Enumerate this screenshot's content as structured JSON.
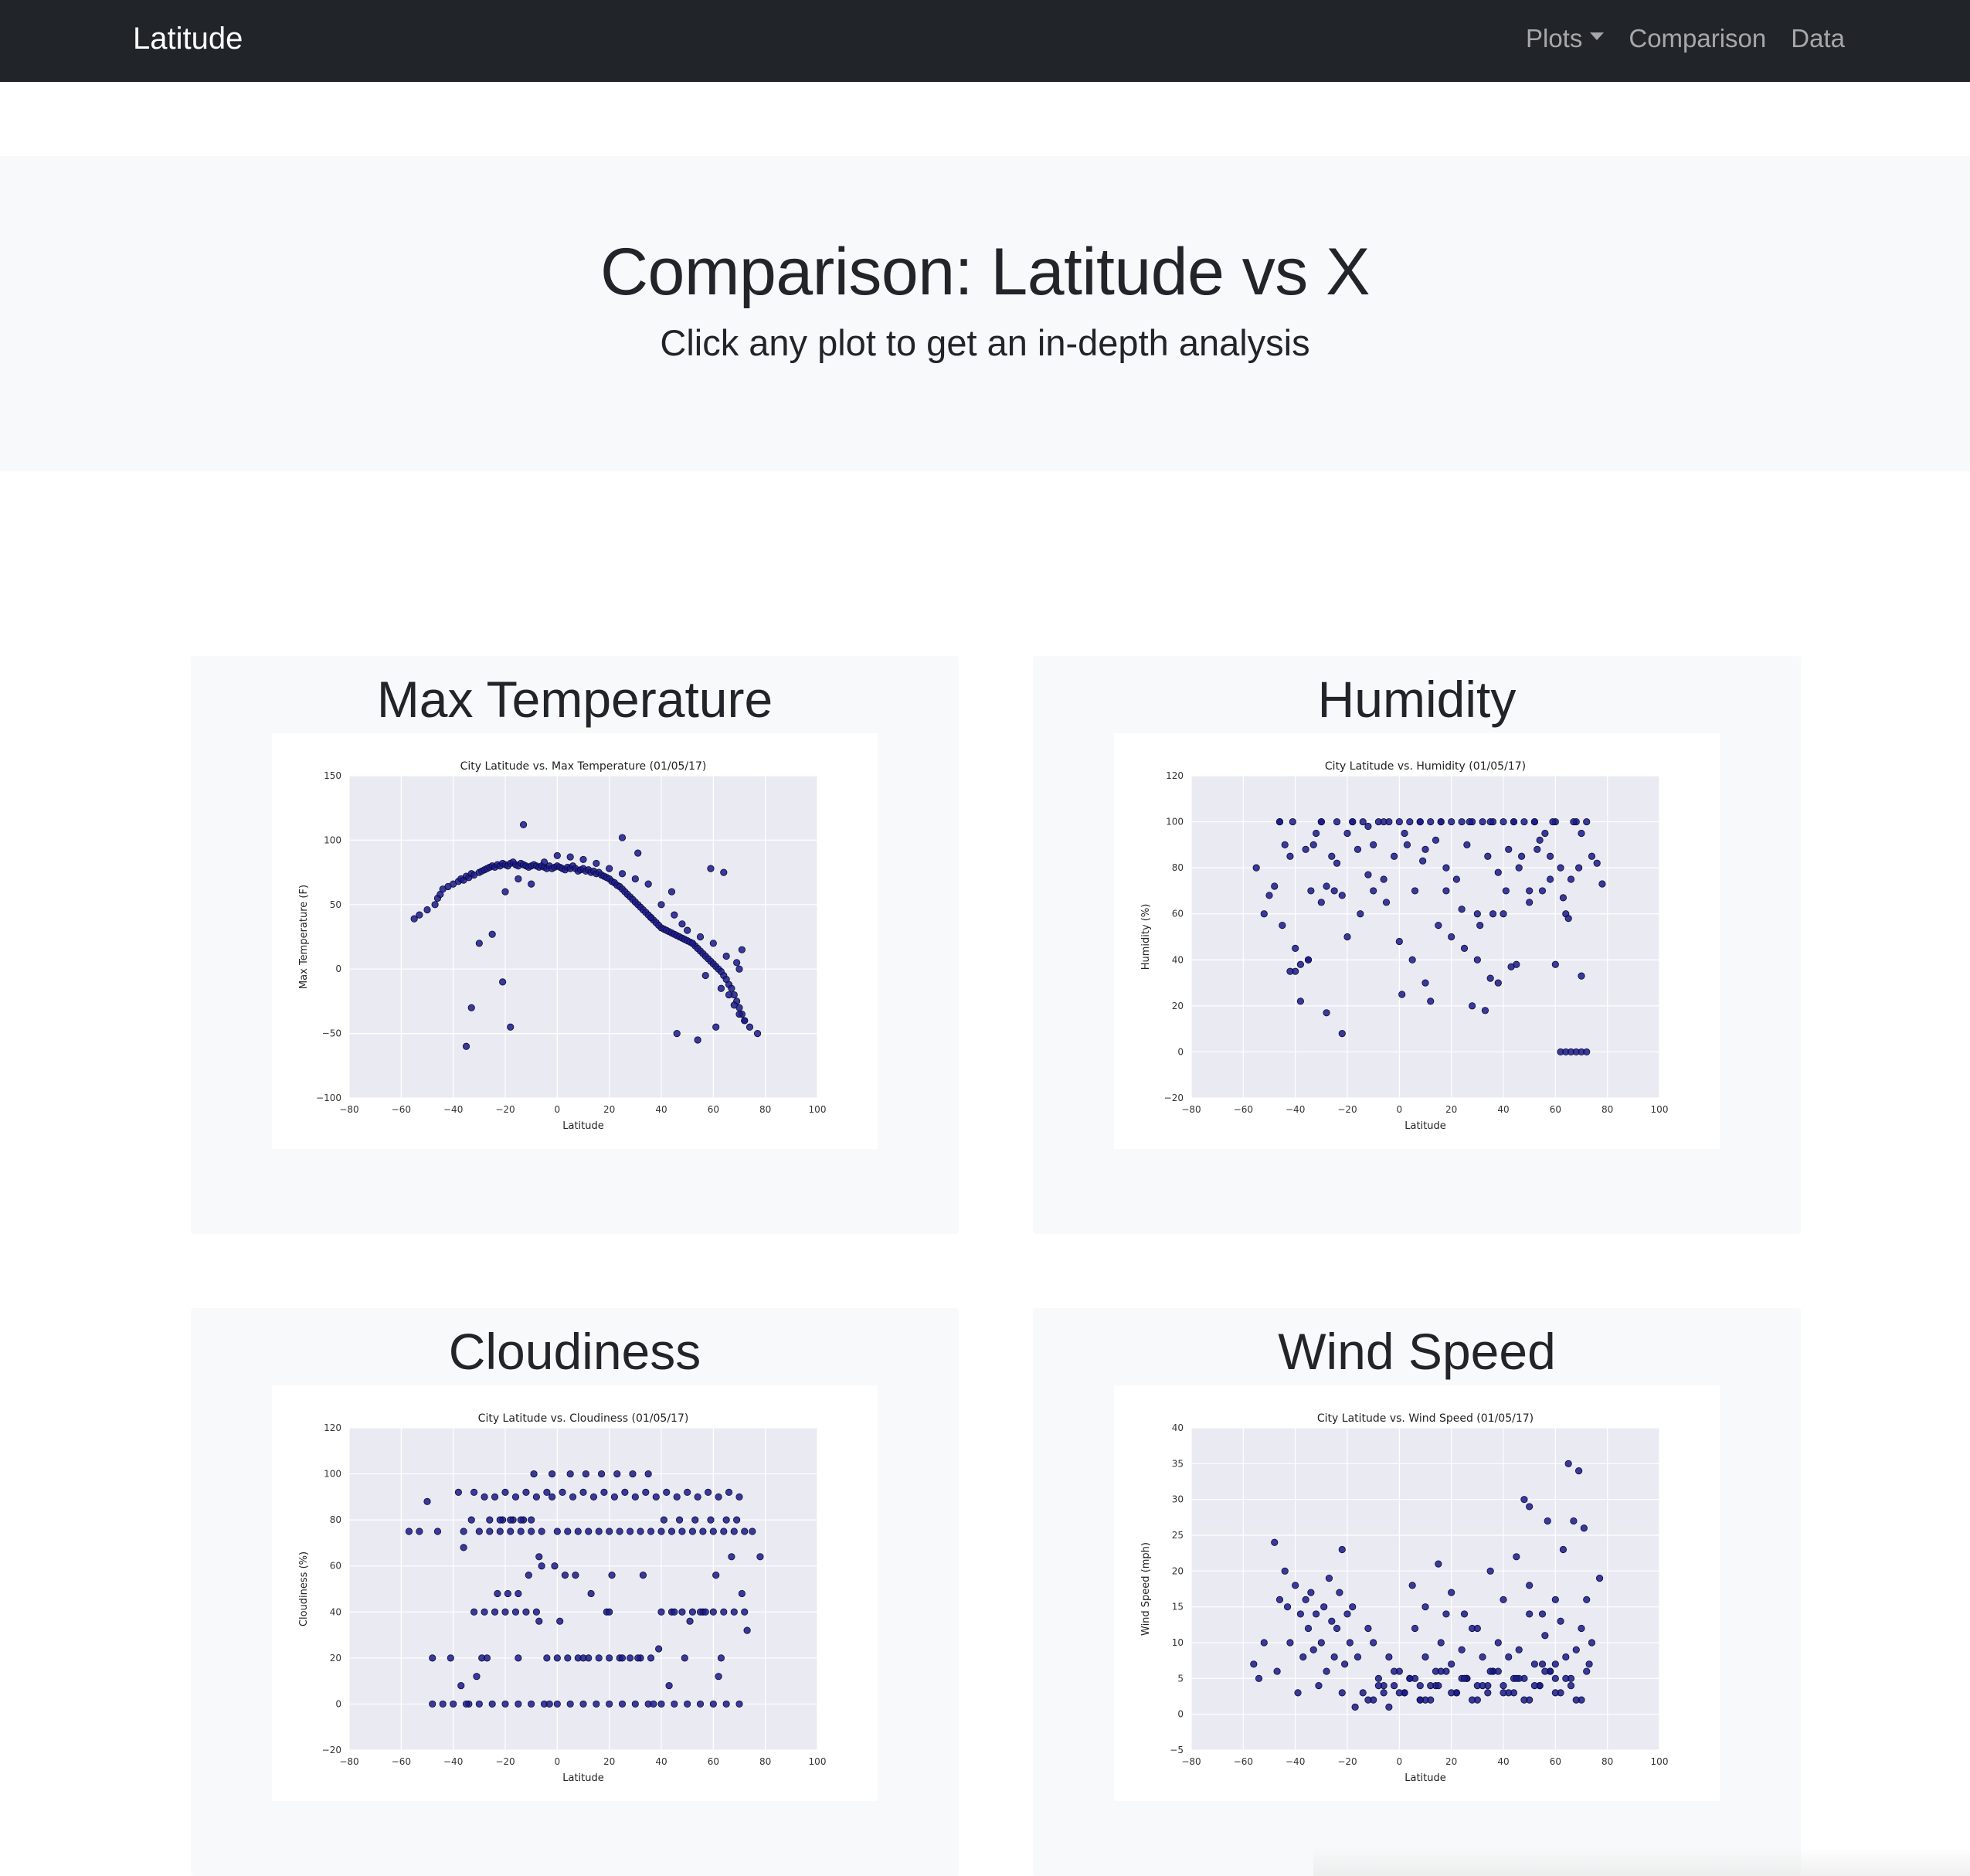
{
  "navbar": {
    "brand": "Latitude",
    "links": [
      {
        "label": "Plots",
        "dropdown": true
      },
      {
        "label": "Comparison"
      },
      {
        "label": "Data"
      }
    ]
  },
  "hero": {
    "title": "Comparison: Latitude vs X",
    "subtitle": "Click any plot to get an in-depth analysis"
  },
  "colors": {
    "navbar": "#212529",
    "panel": "#f8f9fa",
    "plot_bg": "#eaeaf2",
    "marker": "#1a1a8a"
  },
  "cards": [
    {
      "heading": "Max Temperature"
    },
    {
      "heading": "Humidity"
    },
    {
      "heading": "Cloudiness"
    },
    {
      "heading": "Wind Speed"
    }
  ],
  "chart_data": [
    {
      "type": "scatter",
      "title": "City Latitude vs. Max Temperature (01/05/17)",
      "xlabel": "Latitude",
      "ylabel": "Max Temperature (F)",
      "xlim": [
        -80,
        100
      ],
      "ylim": [
        -100,
        150
      ],
      "xticks": [
        "−80",
        "−60",
        "−40",
        "−20",
        "0",
        "20",
        "40",
        "60",
        "80",
        "100"
      ],
      "yticks": [
        "−100",
        "−50",
        "0",
        "50",
        "100",
        "150"
      ],
      "grid": true,
      "x": [
        -55,
        -53,
        -50,
        -47,
        -46,
        -45,
        -44,
        -42,
        -40,
        -38,
        -37,
        -36,
        -35,
        -34,
        -33,
        -32,
        -30,
        -29,
        -28,
        -27,
        -26,
        -25,
        -24,
        -23,
        -22,
        -21,
        -20,
        -19,
        -18,
        -17,
        -16,
        -15,
        -14,
        -13,
        -12,
        -11,
        -10,
        -9,
        -8,
        -7,
        -6,
        -5,
        -4,
        -3,
        -2,
        -1,
        0,
        1,
        2,
        3,
        4,
        5,
        6,
        7,
        8,
        9,
        10,
        11,
        12,
        13,
        14,
        15,
        16,
        17,
        18,
        19,
        20,
        21,
        22,
        23,
        24,
        25,
        26,
        27,
        28,
        29,
        30,
        31,
        32,
        33,
        34,
        35,
        36,
        37,
        38,
        39,
        40,
        41,
        42,
        43,
        44,
        45,
        46,
        47,
        48,
        49,
        50,
        51,
        52,
        53,
        54,
        55,
        56,
        57,
        58,
        59,
        60,
        61,
        62,
        63,
        64,
        65,
        66,
        67,
        68,
        69,
        70,
        71,
        72,
        74,
        77,
        -35,
        -30,
        -25,
        -20,
        -15,
        -10,
        -5,
        0,
        5,
        10,
        15,
        20,
        25,
        30,
        35,
        40,
        45,
        50,
        55,
        60,
        65,
        70,
        -21,
        -33,
        -18,
        -13,
        25,
        31,
        36,
        44,
        48,
        52,
        57,
        63,
        66,
        68,
        70,
        72,
        46,
        54,
        61,
        59,
        64,
        69,
        71
      ],
      "y": [
        39,
        42,
        46,
        50,
        55,
        58,
        62,
        64,
        66,
        68,
        70,
        69,
        72,
        71,
        74,
        73,
        75,
        76,
        77,
        78,
        79,
        80,
        79,
        81,
        80,
        82,
        81,
        80,
        82,
        83,
        81,
        80,
        82,
        81,
        80,
        79,
        80,
        81,
        80,
        79,
        80,
        79,
        78,
        80,
        78,
        79,
        80,
        79,
        78,
        77,
        79,
        78,
        80,
        78,
        76,
        77,
        78,
        76,
        77,
        75,
        76,
        74,
        75,
        73,
        72,
        71,
        70,
        68,
        67,
        65,
        64,
        62,
        60,
        58,
        56,
        54,
        52,
        50,
        48,
        46,
        44,
        42,
        40,
        38,
        36,
        34,
        32,
        31,
        30,
        29,
        28,
        27,
        26,
        25,
        24,
        23,
        22,
        21,
        20,
        18,
        16,
        14,
        12,
        10,
        8,
        6,
        4,
        2,
        0,
        -2,
        -5,
        -8,
        -12,
        -15,
        -20,
        -25,
        -30,
        -35,
        -40,
        -45,
        -50,
        -60,
        20,
        27,
        60,
        70,
        66,
        83,
        88,
        87,
        85,
        82,
        78,
        74,
        70,
        66,
        50,
        42,
        30,
        25,
        20,
        10,
        0,
        -10,
        -30,
        -45,
        112,
        102,
        90,
        40,
        60,
        35,
        20,
        -5,
        -15,
        -20,
        -28,
        -35,
        -40,
        -50,
        -55,
        -45,
        78,
        75,
        5,
        15,
        -10,
        -30,
        -25
      ]
    },
    {
      "type": "scatter",
      "title": "City Latitude vs. Humidity (01/05/17)",
      "xlabel": "Latitude",
      "ylabel": "Humidity (%)",
      "xlim": [
        -80,
        100
      ],
      "ylim": [
        -20,
        120
      ],
      "xticks": [
        "−80",
        "−60",
        "−40",
        "−20",
        "0",
        "20",
        "40",
        "60",
        "80",
        "100"
      ],
      "yticks": [
        "−20",
        "0",
        "20",
        "40",
        "60",
        "80",
        "100",
        "120"
      ],
      "grid": true,
      "x": [
        -55,
        -52,
        -48,
        -46,
        -44,
        -42,
        -40,
        -38,
        -36,
        -34,
        -32,
        -30,
        -28,
        -26,
        -24,
        -22,
        -20,
        -18,
        -16,
        -14,
        -12,
        -10,
        -8,
        -6,
        -4,
        -2,
        0,
        2,
        4,
        6,
        8,
        10,
        12,
        14,
        16,
        18,
        20,
        22,
        24,
        26,
        28,
        30,
        32,
        34,
        36,
        38,
        40,
        42,
        44,
        46,
        48,
        50,
        52,
        54,
        56,
        58,
        60,
        62,
        64,
        66,
        68,
        70,
        72,
        74,
        76,
        78,
        -45,
        -40,
        -35,
        -30,
        -25,
        -20,
        -15,
        -10,
        -5,
        0,
        5,
        10,
        15,
        20,
        25,
        30,
        35,
        40,
        45,
        50,
        55,
        60,
        65,
        70,
        -42,
        -38,
        -35,
        -28,
        -22,
        1,
        12,
        28,
        33,
        38,
        43,
        62,
        64,
        66,
        68,
        70,
        72,
        -50,
        -33,
        -24,
        -12,
        3,
        9,
        18,
        24,
        31,
        36,
        41,
        47,
        53,
        58,
        63,
        69,
        -46,
        -41,
        -30,
        -18,
        -6,
        8,
        16,
        27,
        35,
        44,
        52,
        59,
        67
      ],
      "y": [
        80,
        60,
        72,
        100,
        90,
        85,
        35,
        38,
        88,
        70,
        95,
        100,
        72,
        85,
        100,
        68,
        95,
        100,
        88,
        100,
        98,
        90,
        100,
        75,
        100,
        85,
        100,
        95,
        100,
        70,
        100,
        88,
        100,
        92,
        100,
        80,
        100,
        75,
        100,
        90,
        100,
        60,
        100,
        85,
        100,
        78,
        100,
        88,
        100,
        80,
        100,
        70,
        100,
        92,
        95,
        85,
        100,
        80,
        60,
        75,
        100,
        95,
        100,
        85,
        82,
        73,
        55,
        45,
        40,
        65,
        70,
        50,
        60,
        70,
        65,
        48,
        40,
        30,
        55,
        50,
        45,
        40,
        32,
        60,
        38,
        65,
        70,
        38,
        58,
        33,
        35,
        22,
        40,
        17,
        8,
        25,
        22,
        20,
        18,
        30,
        37,
        0,
        0,
        0,
        0,
        0,
        0,
        68,
        90,
        82,
        77,
        90,
        83,
        70,
        62,
        55,
        60,
        70,
        85,
        88,
        75,
        67,
        80,
        100,
        100,
        100,
        100,
        100,
        100,
        100,
        100,
        100,
        100,
        100,
        100,
        100
      ]
    },
    {
      "type": "scatter",
      "title": "City Latitude vs. Cloudiness (01/05/17)",
      "xlabel": "Latitude",
      "ylabel": "Cloudiness (%)",
      "xlim": [
        -80,
        100
      ],
      "ylim": [
        -20,
        120
      ],
      "xticks": [
        "−80",
        "−60",
        "−40",
        "−20",
        "0",
        "20",
        "40",
        "60",
        "80",
        "100"
      ],
      "yticks": [
        "−20",
        "0",
        "20",
        "40",
        "60",
        "80",
        "100",
        "120"
      ],
      "grid": true,
      "x": [
        -57,
        -53,
        -50,
        -48,
        -46,
        -44,
        -40,
        -38,
        -36,
        -34,
        -32,
        -30,
        -28,
        -26,
        -24,
        -22,
        -20,
        -18,
        -16,
        -14,
        -12,
        -10,
        -8,
        -6,
        -4,
        -2,
        0,
        2,
        4,
        6,
        8,
        10,
        12,
        14,
        16,
        18,
        20,
        22,
        24,
        26,
        28,
        30,
        32,
        34,
        36,
        38,
        40,
        42,
        44,
        46,
        48,
        50,
        52,
        54,
        56,
        58,
        60,
        62,
        64,
        66,
        68,
        70,
        72,
        75,
        78,
        -35,
        -30,
        -25,
        -20,
        -15,
        -10,
        -5,
        0,
        5,
        10,
        15,
        20,
        25,
        30,
        35,
        40,
        45,
        50,
        55,
        60,
        65,
        70,
        -36,
        -32,
        -28,
        -24,
        -20,
        -16,
        -12,
        -8,
        -4,
        0,
        4,
        8,
        12,
        16,
        20,
        24,
        28,
        32,
        36,
        40,
        44,
        48,
        52,
        56,
        60,
        64,
        68,
        72,
        -37,
        -31,
        -27,
        -23,
        -19,
        -15,
        -11,
        -7,
        -3,
        1,
        7,
        13,
        19,
        25,
        31,
        37,
        43,
        49,
        55,
        61,
        67,
        71,
        -33,
        -26,
        -21,
        -17,
        -13,
        -9,
        -2,
        5,
        11,
        17,
        23,
        29,
        35,
        41,
        47,
        53,
        59,
        65,
        69,
        -22,
        -18,
        -14,
        -10,
        -6,
        -1,
        3,
        21,
        33,
        45,
        57,
        63,
        -48,
        -41,
        -29,
        -15,
        -7,
        10,
        20,
        39,
        51,
        62,
        73
      ],
      "y": [
        75,
        75,
        88,
        0,
        75,
        0,
        0,
        92,
        75,
        0,
        92,
        75,
        90,
        75,
        90,
        75,
        92,
        75,
        90,
        75,
        92,
        75,
        90,
        75,
        92,
        90,
        75,
        92,
        75,
        90,
        75,
        92,
        75,
        90,
        75,
        92,
        75,
        90,
        75,
        92,
        75,
        90,
        75,
        92,
        75,
        90,
        75,
        92,
        75,
        90,
        75,
        92,
        75,
        90,
        75,
        92,
        75,
        90,
        75,
        92,
        75,
        90,
        75,
        75,
        64,
        0,
        0,
        0,
        0,
        0,
        0,
        0,
        0,
        0,
        0,
        0,
        0,
        0,
        0,
        0,
        0,
        0,
        0,
        0,
        0,
        0,
        0,
        68,
        40,
        40,
        40,
        40,
        40,
        40,
        40,
        20,
        20,
        20,
        20,
        20,
        20,
        20,
        20,
        20,
        20,
        20,
        40,
        40,
        40,
        40,
        40,
        40,
        40,
        40,
        40,
        8,
        12,
        20,
        48,
        48,
        48,
        56,
        64,
        0,
        36,
        56,
        48,
        40,
        20,
        20,
        0,
        8,
        20,
        40,
        56,
        64,
        48,
        80,
        80,
        80,
        80,
        80,
        100,
        100,
        100,
        100,
        100,
        100,
        100,
        100,
        80,
        80,
        80,
        80,
        80,
        80,
        80,
        80,
        80,
        80,
        60,
        60,
        56,
        56,
        56,
        40,
        40,
        20,
        20,
        20,
        20,
        20,
        36,
        20,
        40,
        24,
        36,
        12,
        32,
        12,
        4,
        12,
        24,
        28,
        28,
        8
      ]
    },
    {
      "type": "scatter",
      "title": "City Latitude vs. Wind Speed (01/05/17)",
      "xlabel": "Latitude",
      "ylabel": "Wind Speed (mph)",
      "xlim": [
        -80,
        100
      ],
      "ylim": [
        -5,
        40
      ],
      "xticks": [
        "−80",
        "−60",
        "−40",
        "−20",
        "0",
        "20",
        "40",
        "60",
        "80",
        "100"
      ],
      "yticks": [
        "−5",
        "0",
        "5",
        "10",
        "15",
        "20",
        "25",
        "30",
        "35",
        "40"
      ],
      "grid": true,
      "x": [
        -56,
        -54,
        -52,
        -48,
        -47,
        -46,
        -44,
        -43,
        -42,
        -40,
        -38,
        -37,
        -36,
        -35,
        -34,
        -33,
        -32,
        -30,
        -29,
        -28,
        -27,
        -26,
        -25,
        -24,
        -23,
        -22,
        -21,
        -20,
        -19,
        -18,
        -16,
        -14,
        -12,
        -10,
        -8,
        -6,
        -4,
        -2,
        0,
        2,
        4,
        6,
        8,
        10,
        12,
        14,
        16,
        18,
        20,
        22,
        24,
        26,
        28,
        30,
        32,
        34,
        36,
        38,
        40,
        42,
        44,
        46,
        48,
        50,
        52,
        54,
        56,
        58,
        60,
        62,
        64,
        66,
        68,
        70,
        72,
        74,
        77,
        -10,
        -6,
        -2,
        2,
        6,
        10,
        14,
        18,
        22,
        26,
        30,
        34,
        38,
        42,
        46,
        50,
        54,
        58,
        62,
        66,
        70,
        -8,
        -4,
        0,
        4,
        8,
        12,
        16,
        20,
        24,
        28,
        32,
        36,
        40,
        44,
        48,
        52,
        56,
        60,
        64,
        68,
        72,
        5,
        10,
        15,
        20,
        25,
        30,
        35,
        40,
        45,
        50,
        55,
        60,
        65,
        48,
        50,
        57,
        63,
        67,
        69,
        71,
        73,
        60,
        55,
        45,
        35,
        25,
        15,
        8,
        -12,
        -17,
        -22,
        -31,
        -39,
        -45
      ],
      "y": [
        7,
        5,
        10,
        24,
        6,
        16,
        20,
        15,
        10,
        18,
        14,
        8,
        16,
        12,
        17,
        9,
        14,
        10,
        15,
        6,
        19,
        13,
        8,
        12,
        17,
        23,
        7,
        14,
        10,
        15,
        8,
        3,
        12,
        10,
        5,
        3,
        8,
        4,
        6,
        3,
        5,
        12,
        4,
        8,
        2,
        6,
        10,
        14,
        7,
        3,
        9,
        5,
        12,
        4,
        8,
        3,
        6,
        10,
        4,
        8,
        3,
        9,
        5,
        14,
        7,
        4,
        11,
        6,
        5,
        13,
        8,
        4,
        9,
        12,
        6,
        10,
        19,
        2,
        4,
        6,
        3,
        5,
        2,
        4,
        6,
        3,
        5,
        2,
        4,
        6,
        3,
        5,
        2,
        4,
        6,
        3,
        5,
        2,
        4,
        1,
        3,
        5,
        2,
        4,
        6,
        3,
        5,
        2,
        4,
        6,
        3,
        5,
        2,
        4,
        6,
        3,
        5,
        2,
        16,
        18,
        15,
        21,
        17,
        14,
        12,
        20,
        16,
        22,
        18,
        14,
        16,
        35,
        30,
        29,
        27,
        23,
        27,
        34,
        26,
        7,
        7,
        7,
        5,
        6,
        5,
        4,
        2,
        2,
        1,
        3,
        4,
        3
      ]
    }
  ]
}
